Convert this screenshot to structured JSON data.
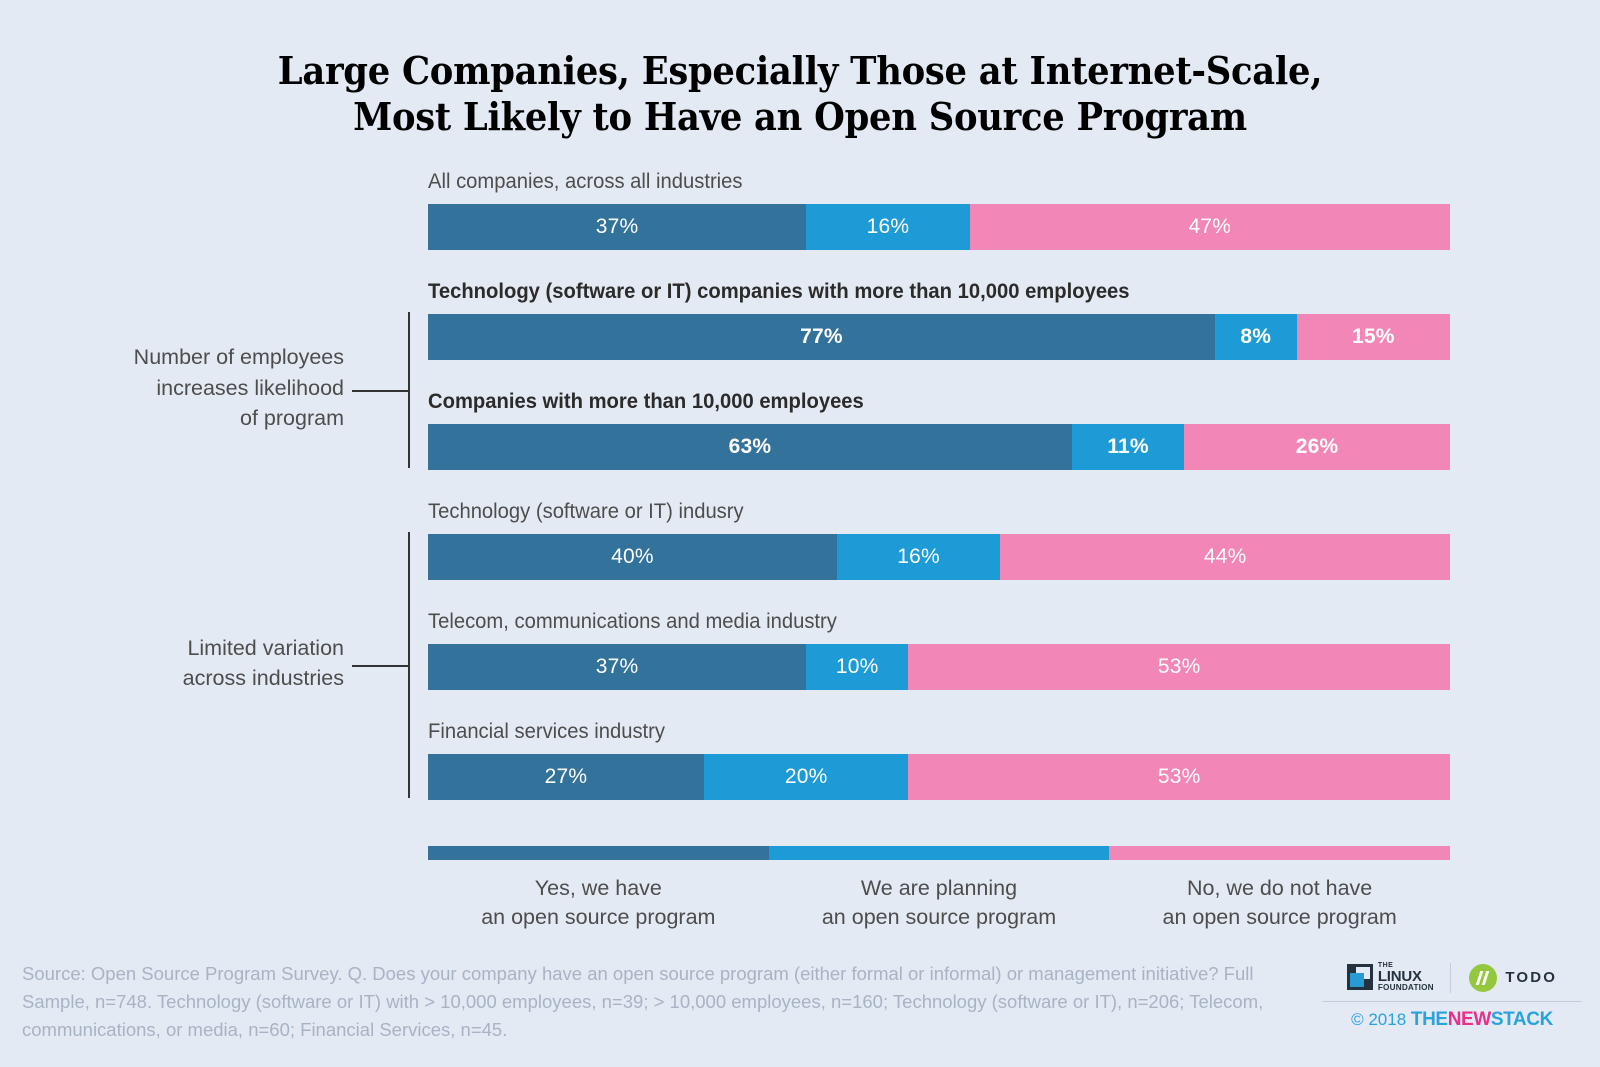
{
  "title": {
    "line1": "Large Companies, Especially Those at Internet-Scale,",
    "line2": "Most Likely to Have an Open Source Program"
  },
  "colors": {
    "background": "#e4eaf4",
    "series_yes": "#33729b",
    "series_planning": "#1d9bd6",
    "series_no": "#f286b6",
    "text": "#4d4d4d",
    "source_text": "#a8b3c4",
    "brand_blue": "#29a3dc",
    "brand_pink": "#e8308a"
  },
  "annotations": [
    {
      "line1": "Number of employees",
      "line2": "increases likelihood",
      "line3": "of program"
    },
    {
      "line1": "Limited variation",
      "line2": "across industries"
    }
  ],
  "legend": {
    "items": [
      {
        "label_line1": "Yes, we have",
        "label_line2": "an open source program",
        "color": "#33729b"
      },
      {
        "label_line1": "We are planning",
        "label_line2": "an open source program",
        "color": "#1d9bd6"
      },
      {
        "label_line1": "No, we do not have",
        "label_line2": "an open source program",
        "color": "#f286b6"
      }
    ]
  },
  "footer": {
    "source": "Source: Open Source Program Survey. Q. Does your company have an open source program (either formal or informal) or management initiative? Full Sample, n=748. Technology (software or IT) with > 10,000 employees, n=39; > 10,000 employees, n=160; Technology (software or IT), n=206; Telecom, communications, or media, n=60; Financial Services, n=45.",
    "lf_the": "THE",
    "lf_linux": "LINUX",
    "lf_foundation": "FOUNDATION",
    "todo": "TODO",
    "copyright_year": "© 2018",
    "tns_the": "THE",
    "tns_new": "NEW",
    "tns_stack": "STACK"
  },
  "chart_data": {
    "type": "bar",
    "orientation": "horizontal",
    "stacked": true,
    "normalized_percent": true,
    "title": "Large Companies, Especially Those at Internet-Scale, Most Likely to Have an Open Source Program",
    "xlabel": "",
    "ylabel": "",
    "xlim": [
      0,
      100
    ],
    "grid": false,
    "legend_position": "bottom",
    "series_names": [
      "Yes, we have an open source program",
      "We are planning an open source program",
      "No, we do not have an open source program"
    ],
    "series_colors": [
      "#33729b",
      "#1d9bd6",
      "#f286b6"
    ],
    "categories": [
      "All companies, across all industries",
      "Technology (software or IT) companies with more than 10,000 employees",
      "Companies with more than 10,000 employees",
      "Technology (software or IT) indusry",
      "Telecom, communications and media industry",
      "Financial services industry"
    ],
    "series": [
      {
        "name": "Yes, we have an open source program",
        "values": [
          37,
          77,
          63,
          40,
          37,
          27
        ]
      },
      {
        "name": "We are planning an open source program",
        "values": [
          16,
          8,
          11,
          16,
          10,
          20
        ]
      },
      {
        "name": "No, we do not have an open source program",
        "values": [
          47,
          15,
          26,
          44,
          53,
          53
        ]
      }
    ],
    "rows": [
      {
        "label": "All companies, across all industries",
        "bold": false,
        "values": [
          37,
          16,
          47
        ],
        "value_labels": [
          "37%",
          "16%",
          "47%"
        ]
      },
      {
        "label": "Technology (software or IT) companies with more than 10,000 employees",
        "bold": true,
        "values": [
          77,
          8,
          15
        ],
        "value_labels": [
          "77%",
          "8%",
          "15%"
        ]
      },
      {
        "label": "Companies with more than 10,000 employees",
        "bold": true,
        "values": [
          63,
          11,
          26
        ],
        "value_labels": [
          "63%",
          "11%",
          "26%"
        ]
      },
      {
        "label": "Technology (software or IT) indusry",
        "bold": false,
        "values": [
          40,
          16,
          44
        ],
        "value_labels": [
          "40%",
          "16%",
          "44%"
        ]
      },
      {
        "label": "Telecom, communications and media industry",
        "bold": false,
        "values": [
          37,
          10,
          53
        ],
        "value_labels": [
          "37%",
          "10%",
          "53%"
        ]
      },
      {
        "label": "Financial services industry",
        "bold": false,
        "values": [
          27,
          20,
          53
        ],
        "value_labels": [
          "27%",
          "20%",
          "53%"
        ]
      }
    ],
    "sample_sizes": {
      "Full Sample": 748,
      "Technology (software or IT) with > 10,000 employees": 39,
      "> 10,000 employees": 160,
      "Technology (software or IT)": 206,
      "Telecom, communications, or media": 60,
      "Financial Services": 45
    }
  }
}
